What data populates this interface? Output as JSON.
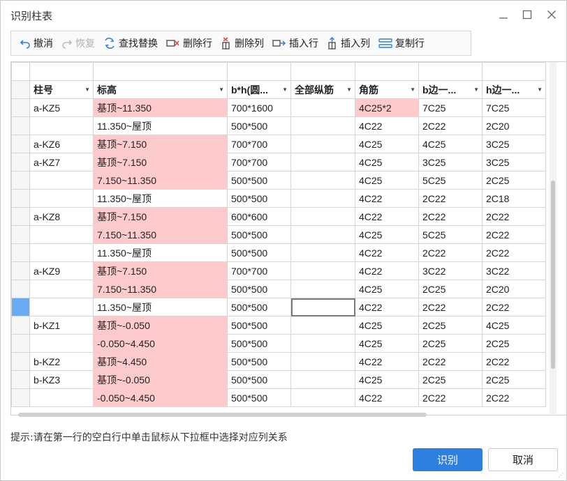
{
  "window": {
    "title": "识别柱表"
  },
  "toolbar": {
    "undo": "撤消",
    "redo": "恢复",
    "find_replace": "查找替换",
    "delete_row": "删除行",
    "delete_col": "删除列",
    "insert_row": "插入行",
    "insert_col": "插入列",
    "copy_row": "复制行"
  },
  "columns": [
    "柱号",
    "标高",
    "b*h(圆...",
    "全部纵筋",
    "角筋",
    "b边一...",
    "h边一..."
  ],
  "rows": [
    [
      "a-KZ5",
      "基顶~11.350",
      "700*1600",
      "",
      "4C25*2",
      "7C25",
      "7C25"
    ],
    [
      "",
      "11.350~屋顶",
      "500*500",
      "",
      "4C22",
      "2C22",
      "2C20"
    ],
    [
      "a-KZ6",
      "基顶~7.150",
      "700*700",
      "",
      "4C25",
      "4C25",
      "3C25"
    ],
    [
      "a-KZ7",
      "基顶~7.150",
      "700*700",
      "",
      "4C25",
      "3C25",
      "3C25"
    ],
    [
      "",
      "7.150~11.350",
      "500*500",
      "",
      "4C25",
      "5C25",
      "2C25"
    ],
    [
      "",
      "11.350~屋顶",
      "500*500",
      "",
      "4C22",
      "2C22",
      "2C18"
    ],
    [
      "a-KZ8",
      "基顶~7.150",
      "600*600",
      "",
      "4C22",
      "2C22",
      "2C22"
    ],
    [
      "",
      "7.150~11.350",
      "500*500",
      "",
      "4C25",
      "5C25",
      "2C22"
    ],
    [
      "",
      "11.350~屋顶",
      "500*500",
      "",
      "4C22",
      "2C22",
      "2C22"
    ],
    [
      "a-KZ9",
      "基顶~7.150",
      "700*700",
      "",
      "4C22",
      "3C22",
      "3C22"
    ],
    [
      "",
      "7.150~11.350",
      "500*500",
      "",
      "4C25",
      "2C25",
      "2C20"
    ],
    [
      "",
      "11.350~屋顶",
      "500*500",
      "",
      "4C22",
      "2C22",
      "2C22"
    ],
    [
      "b-KZ1",
      "基顶~-0.050",
      "500*500",
      "",
      "4C25",
      "2C25",
      "4C25"
    ],
    [
      "",
      "-0.050~4.450",
      "500*500",
      "",
      "4C25",
      "2C25",
      "2C25"
    ],
    [
      "b-KZ2",
      "基顶~4.450",
      "500*500",
      "",
      "4C22",
      "2C22",
      "2C22"
    ],
    [
      "b-KZ3",
      "基顶~-0.050",
      "500*500",
      "",
      "4C25",
      "2C25",
      "2C25"
    ],
    [
      "",
      "-0.050~4.450",
      "500*500",
      "",
      "4C22",
      "2C22",
      "2C22"
    ]
  ],
  "highlight_color": "#fdcbcb",
  "selection_color": "#84b9f6",
  "hint": "提示:请在第一行的空白行中单击鼠标从下拉框中选择对应列关系",
  "buttons": {
    "recognize": "识别",
    "cancel": "取消"
  }
}
